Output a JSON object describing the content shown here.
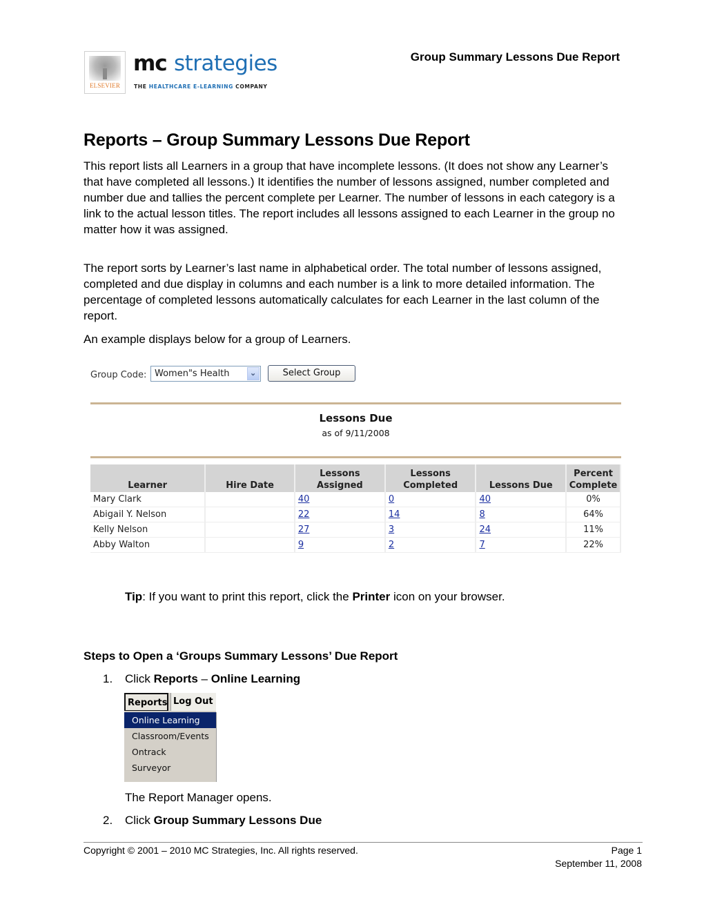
{
  "header": {
    "logo": {
      "publisher": "ELSEVIER",
      "brand_mc": "mc",
      "brand_strategies": "strategies",
      "tagline_the": "THE ",
      "tagline_middle": "HEALTHCARE E-LEARNING",
      "tagline_company": " COMPANY"
    },
    "title": "Group Summary Lessons Due Report"
  },
  "main": {
    "heading": "Reports – Group Summary Lessons Due Report",
    "paragraphs": [
      "This report lists all Learners in a group that have incomplete lessons. (It does not show any Learner’s that have completed all lessons.) It identifies the number of lessons assigned, number completed and number due and tallies the percent complete per Learner. The number of lessons in each category is a link to the actual lesson titles. The report includes all lessons assigned to each Learner in the group no matter how it was assigned.",
      "The report sorts by Learner’s last name in alphabetical order. The total number of lessons assigned, completed and due display in columns and each number is a link to more detailed information. The percentage of completed lessons automatically calculates for each Learner in the last column of the report.",
      "An example displays below for a group of Learners."
    ]
  },
  "example": {
    "group_code_label": "Group Code:",
    "group_code_value": "Women\"s Health",
    "select_button": "Select Group",
    "report_title": "Lessons Due",
    "report_subtitle": "as of 9/11/2008",
    "columns": {
      "learner": "Learner",
      "hire_date": "Hire Date",
      "assigned_1": "Lessons",
      "assigned_2": "Assigned",
      "completed_1": "Lessons",
      "completed_2": "Completed",
      "due": "Lessons Due",
      "pct_1": "Percent",
      "pct_2": "Complete"
    },
    "rows": [
      {
        "learner": "Mary Clark",
        "hire_date": "",
        "assigned": "40",
        "completed": "0",
        "due": "40",
        "pct": "0%"
      },
      {
        "learner": "Abigail Y. Nelson",
        "hire_date": "",
        "assigned": "22",
        "completed": "14",
        "due": "8",
        "pct": "64%"
      },
      {
        "learner": "Kelly Nelson",
        "hire_date": "",
        "assigned": "27",
        "completed": "3",
        "due": "24",
        "pct": "11%"
      },
      {
        "learner": "Abby Walton",
        "hire_date": "",
        "assigned": "9",
        "completed": "2",
        "due": "7",
        "pct": "22%"
      }
    ]
  },
  "tip": {
    "label": "Tip",
    "text_1": ": If you want to print this report, click the ",
    "bold": "Printer",
    "text_2": " icon on your browser."
  },
  "steps": {
    "heading": "Steps to Open a ‘Groups Summary Lessons’ Due Report",
    "items": [
      {
        "num": "1.",
        "text": "Click ",
        "bold_1": "Reports",
        "sep": " – ",
        "bold_2": "Online Learning"
      },
      {
        "num": "2.",
        "text": "Click ",
        "bold_1": "Group Summary Lessons Due"
      }
    ],
    "note": "The Report Manager opens.",
    "menu": {
      "tabs": [
        "Reports",
        "Log Out"
      ],
      "items": [
        "Online Learning",
        "Classroom/Events",
        "Ontrack",
        "Surveyor"
      ],
      "active_index": 0
    }
  },
  "footer": {
    "copyright": "Copyright © 2001 – 2010 MC Strategies, Inc. All rights reserved.",
    "page": "Page 1",
    "date": "September 11, 2008"
  }
}
